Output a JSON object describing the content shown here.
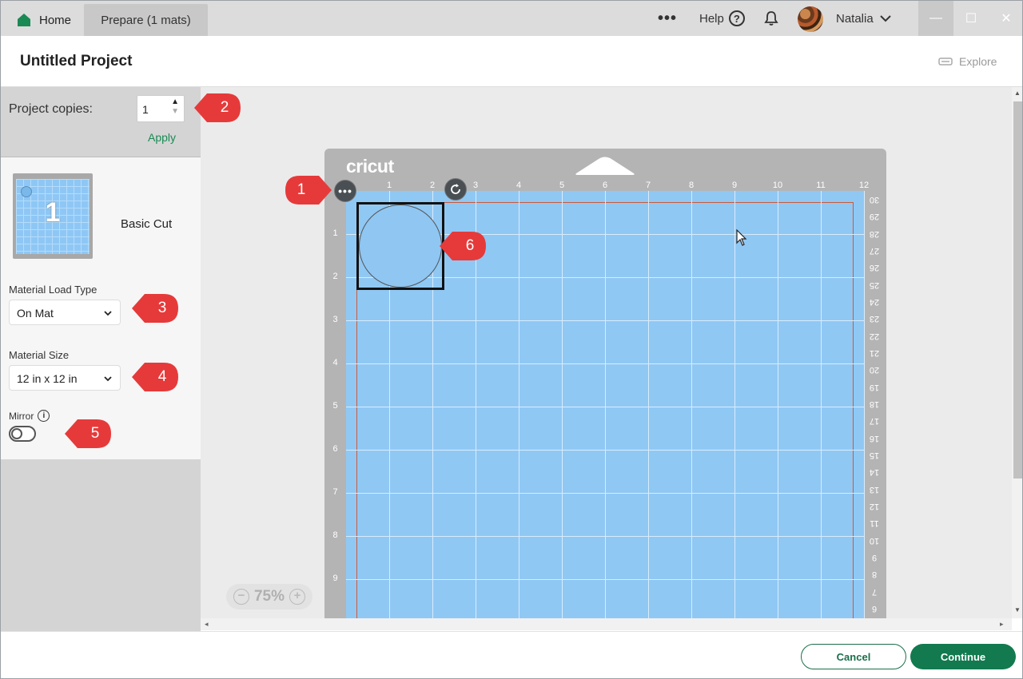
{
  "titlebar": {
    "tabs": [
      {
        "label": "Home"
      },
      {
        "label": "Prepare (1 mats)"
      }
    ],
    "help_label": "Help",
    "user_name": "Natalia"
  },
  "header": {
    "title": "Untitled Project",
    "explore_label": "Explore"
  },
  "sidebar": {
    "copies_label": "Project copies:",
    "copies_value": "1",
    "apply_label": "Apply",
    "mat_number": "1",
    "mat_name": "Basic Cut",
    "load_type_label": "Material Load Type",
    "load_type_value": "On Mat",
    "size_label": "Material Size",
    "size_value": "12 in x 12 in",
    "mirror_label": "Mirror",
    "mirror_on": false
  },
  "canvas": {
    "brand": "cricut",
    "top_ruler": [
      "1",
      "2",
      "3",
      "4",
      "5",
      "6",
      "7",
      "8",
      "9",
      "10",
      "11",
      "12"
    ],
    "left_ruler": [
      "1",
      "2",
      "3",
      "4",
      "5",
      "6",
      "7",
      "8",
      "9"
    ],
    "right_ruler": [
      "30",
      "29",
      "28",
      "27",
      "26",
      "25",
      "24",
      "23",
      "22",
      "21",
      "20",
      "19",
      "18",
      "17",
      "16",
      "15",
      "14",
      "13",
      "12",
      "11",
      "10",
      "9",
      "8",
      "7",
      "6"
    ],
    "zoom_label": "75%"
  },
  "callouts": [
    "1",
    "2",
    "3",
    "4",
    "5",
    "6"
  ],
  "footer": {
    "cancel_label": "Cancel",
    "continue_label": "Continue"
  },
  "colors": {
    "brand_green": "#127a4e",
    "mat_blue": "#90c8f4",
    "callout_red": "#e63a3a"
  }
}
